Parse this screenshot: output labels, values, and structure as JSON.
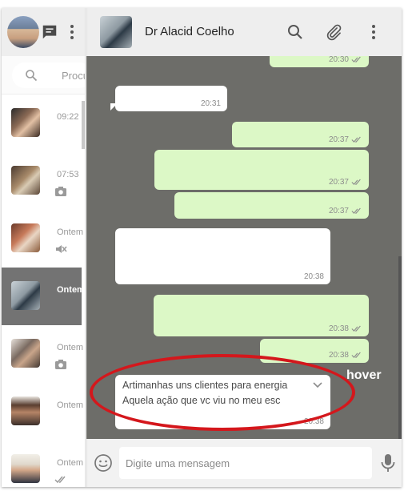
{
  "left_header": {
    "icons": [
      "avatar",
      "status-icon",
      "menu-icon"
    ]
  },
  "search": {
    "placeholder": "Procurar"
  },
  "chat_list": [
    {
      "time": "09:22",
      "sub_icon": ""
    },
    {
      "time": "07:53",
      "sub_icon": "camera-icon"
    },
    {
      "time": "Ontem",
      "sub_icon": "muted-icon"
    },
    {
      "time": "Ontem",
      "sub_icon": "",
      "active": true
    },
    {
      "time": "Ontem",
      "sub_icon": "camera-icon"
    },
    {
      "time": "Ontem",
      "sub_icon": ""
    },
    {
      "time": "Ontem",
      "sub_icon": "double-check-icon"
    }
  ],
  "chat_header": {
    "contact_name": "Dr Alacid Coelho"
  },
  "messages": [
    {
      "dir": "out",
      "time": "20:30",
      "ticks": "double-check"
    },
    {
      "dir": "in",
      "time": "20:31"
    },
    {
      "dir": "out",
      "time": "20:37",
      "ticks": "double-check"
    },
    {
      "dir": "out",
      "time": "20:37",
      "ticks": "double-check"
    },
    {
      "dir": "out",
      "time": "20:37",
      "ticks": "double-check"
    },
    {
      "dir": "in",
      "time": "20:38"
    },
    {
      "dir": "out",
      "time": "20:38",
      "ticks": "double-check"
    },
    {
      "dir": "out",
      "time": "20:38",
      "ticks": "double-check"
    },
    {
      "dir": "in",
      "time": "20:38",
      "lines": [
        "Artimanhas uns clientes para energia",
        "Aquela ação que vc viu no meu esc"
      ]
    }
  ],
  "annotation": {
    "label": "hover",
    "color": "#d4171c"
  },
  "composer": {
    "placeholder": "Digite uma mensagem"
  },
  "colors": {
    "outgoing_bubble": "#dcf8c6",
    "incoming_bubble": "#ffffff",
    "chat_background": "#6d6d69",
    "active_chat": "#737373"
  }
}
